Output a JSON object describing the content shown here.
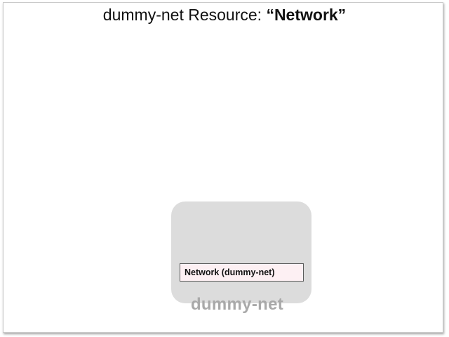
{
  "title": {
    "prefix": "dummy-net Resource: ",
    "emphasis": "“Network”"
  },
  "diagram": {
    "container": {
      "label": "dummy-net",
      "fill_color": "#dcdcdc",
      "label_color": "#a9a9a9"
    },
    "resource": {
      "label": "Network (dummy-net)",
      "fill_color": "#fdf0f3",
      "border_color": "#5a5a5a"
    }
  }
}
